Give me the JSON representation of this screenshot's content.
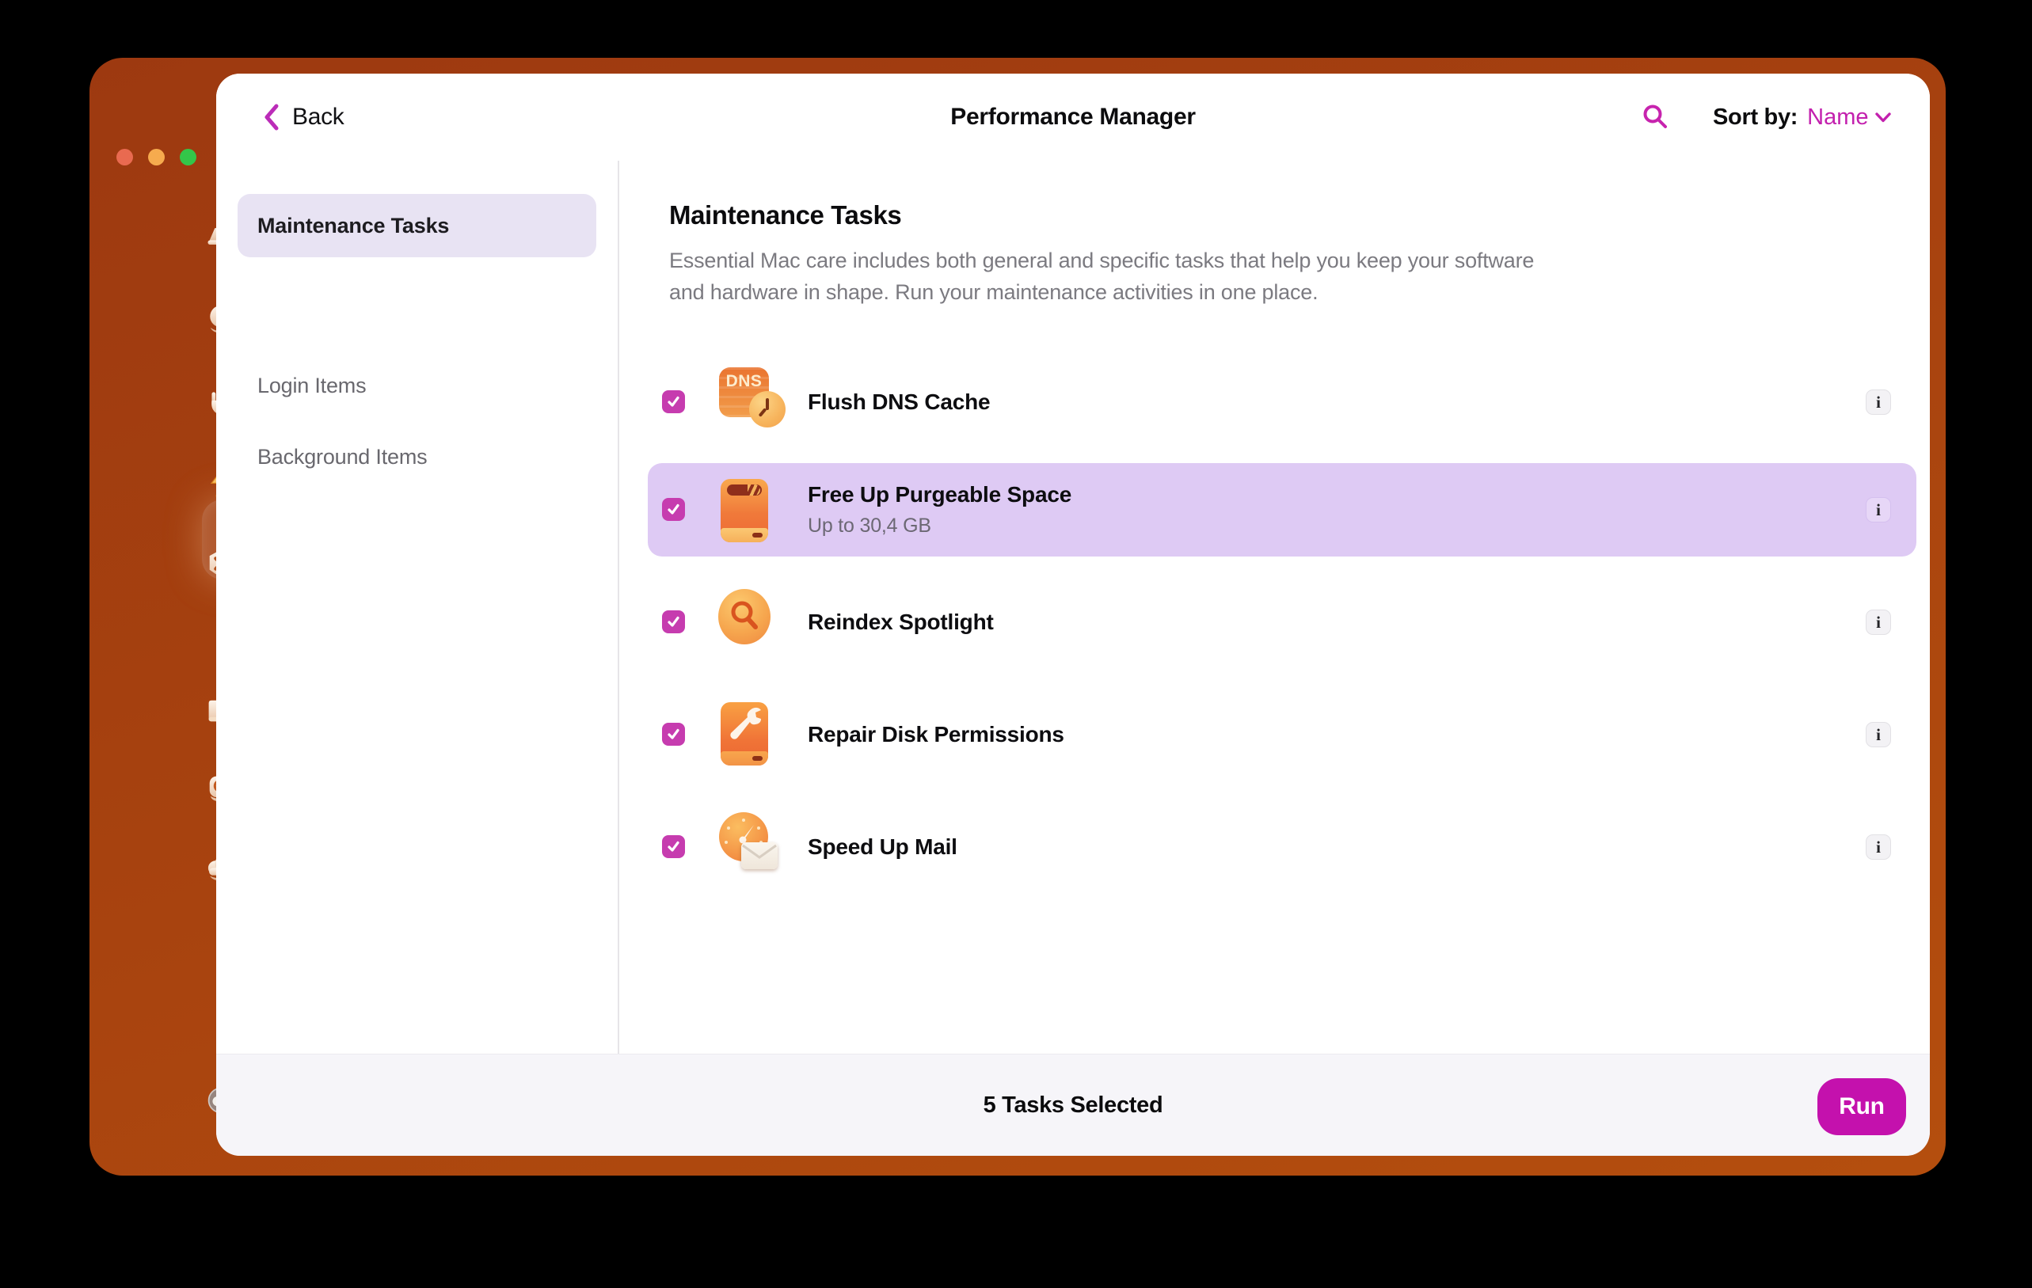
{
  "window": {
    "traffic_lights": [
      {
        "name": "close",
        "color": "#e96a50"
      },
      {
        "name": "minimize",
        "color": "#f6ab4e"
      },
      {
        "name": "zoom",
        "color": "#33c649"
      }
    ]
  },
  "header": {
    "back_label": "Back",
    "title": "Performance Manager",
    "sort_label": "Sort by:",
    "sort_value": "Name"
  },
  "sidebar": {
    "selected": "performance",
    "icons": [
      {
        "name": "smart-care"
      },
      {
        "name": "cleanup"
      },
      {
        "name": "protection"
      },
      {
        "name": "performance",
        "badge": true,
        "selected": true
      },
      {
        "name": "applications"
      },
      {
        "name": "my-clutter"
      },
      {
        "name": "space-lens"
      },
      {
        "name": "cloud-storage"
      },
      {
        "name": "assistant-avatar"
      }
    ]
  },
  "nav": {
    "items": [
      {
        "label": "Maintenance Tasks",
        "selected": true
      },
      {
        "label": "Login Items",
        "selected": false
      },
      {
        "label": "Background Items",
        "selected": false
      }
    ]
  },
  "main": {
    "heading": "Maintenance Tasks",
    "description": "Essential Mac care includes both general and specific tasks that help you keep your software and hardware in shape. Run your maintenance activities in one place."
  },
  "tasks": [
    {
      "title": "Flush DNS Cache",
      "checked": true,
      "icon": "dns-clock",
      "icon_text": "DNS",
      "info": "i"
    },
    {
      "title": "Free Up Purgeable Space",
      "subtitle": "Up to 30,4 GB",
      "checked": true,
      "highlighted": true,
      "icon": "external-drive",
      "info": "i"
    },
    {
      "title": "Reindex Spotlight",
      "checked": true,
      "icon": "spotlight-magnifier",
      "info": "i"
    },
    {
      "title": "Repair Disk Permissions",
      "checked": true,
      "icon": "drive-wrench",
      "info": "i"
    },
    {
      "title": "Speed Up Mail",
      "checked": true,
      "icon": "mail-gauge",
      "info": "i"
    }
  ],
  "footer": {
    "status": "5 Tasks Selected",
    "run_label": "Run"
  },
  "colors": {
    "accent": "#c320ae",
    "checkbox": "#c63caf",
    "run_button": "#c411ad",
    "highlight_row": "#decaf4",
    "nav_selected_bg": "#e8e3f3",
    "frame": "#a7420f",
    "footer_bg": "#f6f5f9"
  }
}
